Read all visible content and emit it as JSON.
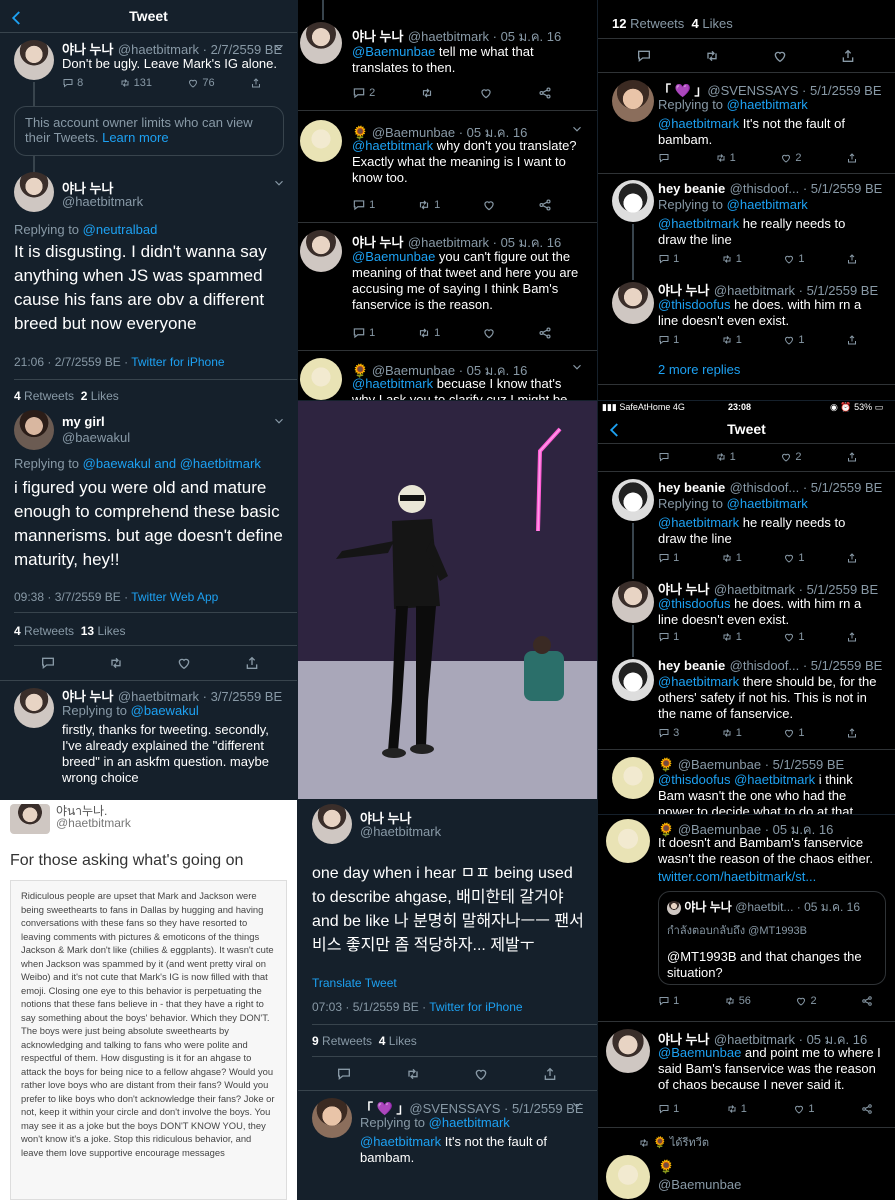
{
  "p1": {
    "title": "Tweet",
    "t1": {
      "name": "야나 누나",
      "handle": "@haetbitmark · 2/7/2559 BE",
      "text": "Don't be ugly. Leave Mark's IG alone.",
      "replies": "8",
      "rts": "131",
      "likes": "76"
    },
    "limit": {
      "text": "This account owner limits who can view their Tweets.",
      "link": "Learn more"
    },
    "main": {
      "name": "야나 누나",
      "handle": "@haetbitmark",
      "replying_prefix": "Replying to",
      "replying_to": "@neutralbad",
      "text": "It is disgusting. I didn't wanna say anything when JS was spammed cause his fans are obv a different breed but now everyone",
      "time": "21:06 · 2/7/2559 BE · ",
      "client": "Twitter for iPhone",
      "rt_n": "4",
      "rt_l": "Retweets",
      "lk_n": "2",
      "lk_l": "Likes"
    },
    "girl": {
      "name": "my girl",
      "handle": "@baewakul",
      "replying_prefix": "Replying to",
      "replying_to": "@baewakul and @haetbitmark",
      "text": "i figured you were old and mature enough to comprehend these basic mannerisms. but age doesn't define maturity, hey!!",
      "time": "09:38 · 3/7/2559 BE · ",
      "client": "Twitter Web App",
      "rt_n": "4",
      "rt_l": "Retweets",
      "lk_n": "13",
      "lk_l": "Likes"
    },
    "reply": {
      "name": "야나 누나",
      "handle": "@haetbitmark · 3/7/2559 BE",
      "replying_prefix": "Replying to",
      "replying_to": "@baewakul",
      "text": "firstly, thanks for tweeting. secondly, I've already explained the \"different breed\" in an askfm question. maybe wrong choice"
    }
  },
  "p2": {
    "a": {
      "name": "야나 누나",
      "handle": "@haetbitmark · 05 ม.ค. 16",
      "mention": "@Baemunbae",
      "text": " tell me what that translates to then.",
      "replies": "2"
    },
    "b": {
      "name": "@Baemunbae · 05 ม.ค. 16",
      "mention": "@haetbitmark",
      "text": " why don't you translate? Exactly what the meaning is I want to know too.",
      "replies": "1",
      "rts": "1"
    },
    "c": {
      "name": "야나 누나",
      "handle": "@haetbitmark · 05 ม.ค. 16",
      "mention": "@Baemunbae",
      "text": " you can't figure out the meaning of that tweet and here you are accusing me of saying I think Bam's fanservice is the reason.",
      "replies": "1",
      "rts": "1"
    },
    "d": {
      "name": "@Baemunbae · 05 ม.ค. 16",
      "mention": "@haetbitmark",
      "text": " becuase I know that's why I ask you to clarify cuz I might be wrong"
    }
  },
  "p3": {
    "stats": {
      "rt_n": "12",
      "rt_l": "Retweets",
      "lk_n": "4",
      "lk_l": "Likes"
    },
    "a": {
      "name": "「 💜 」",
      "handle": "@SVENSSAYS · 5/1/2559 BE",
      "replying_prefix": "Replying to",
      "replying_to": "@haetbitmark",
      "mention": "@haetbitmark",
      "text": " It's not the fault of bambam.",
      "rts": "1",
      "likes": "2"
    },
    "b": {
      "name": "hey beanie",
      "handle": "@thisdoof... · 5/1/2559 BE",
      "replying_prefix": "Replying to",
      "replying_to": "@haetbitmark",
      "mention": "@haetbitmark",
      "text": " he really needs to draw the line",
      "replies": "1",
      "rts": "1",
      "likes": "1"
    },
    "c": {
      "name": "야나 누나",
      "handle": "@haetbitmark · 5/1/2559 BE",
      "mention": "@thisdoofus",
      "text": " he does. with him rn a line doesn't even exist.",
      "replies": "1",
      "rts": "1",
      "likes": "1"
    },
    "more": "2 more replies"
  },
  "p4": {
    "alt": "dancer video frame"
  },
  "p5": {
    "status": {
      "carrier": "SafeAtHome",
      "net": "4G",
      "time": "23:08",
      "battery": "53%"
    },
    "title": "Tweet",
    "top": {
      "rts": "1",
      "likes": "2"
    },
    "a": {
      "name": "hey beanie",
      "handle": "@thisdoof... · 5/1/2559 BE",
      "replying_prefix": "Replying to",
      "replying_to": "@haetbitmark",
      "mention": "@haetbitmark",
      "text": " he really needs to draw the line",
      "replies": "1",
      "rts": "1",
      "likes": "1"
    },
    "b": {
      "name": "야나 누나",
      "handle": "@haetbitmark · 5/1/2559 BE",
      "mention": "@thisdoofus",
      "text": " he does. with him rn a line doesn't even exist.",
      "replies": "1",
      "rts": "1",
      "likes": "1"
    },
    "c": {
      "name": "hey beanie",
      "handle": "@thisdoof... · 5/1/2559 BE",
      "mention": "@haetbitmark",
      "text": " there should be, for the others' safety if not his. This is not in the name of fanservice.",
      "replies": "3",
      "rts": "1",
      "likes": "1"
    },
    "d": {
      "name": "@Baemunbae · 5/1/2559 BE",
      "mention": "@thisdoofus @haetbitmark",
      "text": " i think Bam wasn't the one who had the power to decide what to do at that time. The staff"
    }
  },
  "p6": {
    "name": "야นา누나.",
    "handle": "@haetbitmark",
    "heading": "For those asking what's going on",
    "body": "Ridiculous people are upset that Mark and Jackson were being sweethearts to fans in Dallas by hugging and having conversations with these fans so they have resorted to leaving comments with pictures & emoticons of the things Jackson & Mark don't like (chilies & eggplants). It wasn't cute when Jackson was spammed by it (and went pretty viral on Weibo) and it's not cute that Mark's IG is now filled with that emoji. Closing one eye to this behavior is perpetuating the notions that these fans believe in - that they have a right to say something about the boys' behavior. Which they DON'T. The boys were just being absolute sweethearts by acknowledging and talking to fans who were polite and respectful of them. How disgusting is it for an ahgase to attack the boys for being nice to a fellow ahgase? Would you rather love boys who are distant from their fans? Would you prefer to like boys who don't acknowledge their fans? Joke or not, keep it within your circle and don't involve the boys. You may see it as a joke but the boys DON'T KNOW YOU, they won't know it's a joke. Stop this ridiculous behavior, and leave them love supportive encourage messages"
  },
  "p7": {
    "name": "야나 누나",
    "handle": "@haetbitmark",
    "text": "one day when i hear ㅁㅍ being used to describe ahgase, 배미한테 갈거야 and be like 나 분명히 말해자나ㅡㅡ 팬서비스 좋지만 좀 적당하자... 제발ㅜ",
    "translate": "Translate Tweet",
    "time": "07:03 · 5/1/2559 BE · ",
    "client": "Twitter for iPhone",
    "rt_n": "9",
    "rt_l": "Retweets",
    "lk_n": "4",
    "lk_l": "Likes",
    "reply": {
      "name": "「 💜 」",
      "handle": "@SVENSSAYS · 5/1/2559 BE",
      "replying_prefix": "Replying to",
      "replying_to": "@haetbitmark",
      "mention": "@haetbitmark",
      "text": " It's not the fault of bambam."
    }
  },
  "p8": {
    "a": {
      "name": "@Baemunbae · 05 ม.ค. 16",
      "text": "It doesn't and Bambam's fanservice wasn't the reason of the chaos either.",
      "link": "twitter.com/haetbitmark/st...",
      "replies": "1",
      "rts": "56",
      "likes": "2"
    },
    "quote": {
      "name": "야나 누나",
      "handle": "@haetbit... · 05 ม.ค. 16",
      "sub": "กำลังตอบกลับถึง @MT1993B",
      "text": "@MT1993B and that changes the situation?"
    },
    "b": {
      "name": "야나 누나",
      "handle": "@haetbitmark · 05 ม.ค. 16",
      "mention": "@Baemunbae",
      "text": " and point me to where I said Bam's fanservice was the reason of chaos because I never said it.",
      "replies": "1",
      "rts": "1",
      "likes": "1"
    },
    "rt_label": "🌻 ได้รีทวีต",
    "c": {
      "name": "🌻",
      "handle": "@Baemunbae"
    }
  },
  "colors": {
    "accent": "#1da1f2",
    "dim": "#15202b",
    "black": "#000000"
  }
}
